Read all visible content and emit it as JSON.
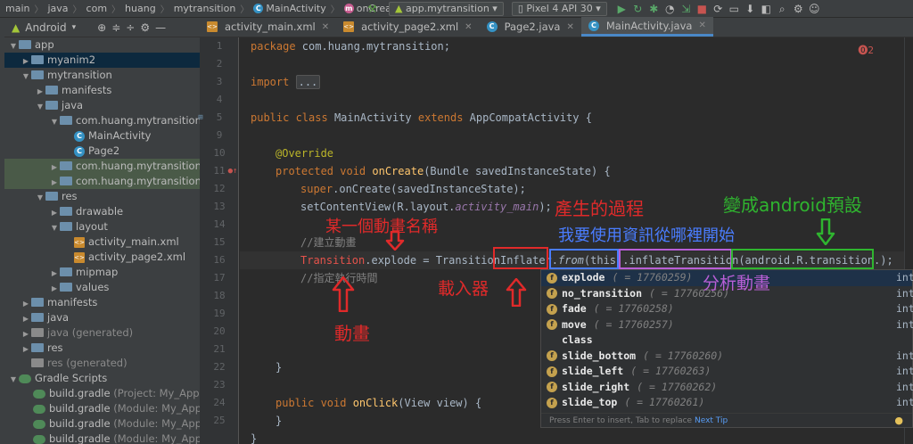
{
  "breadcrumbs": [
    "main",
    "java",
    "com",
    "huang",
    "mytransition",
    "MainActivity",
    "onCreate"
  ],
  "toolbar": {
    "config": "app.mytransition",
    "device": "Pixel 4 API 30"
  },
  "project": {
    "view": "Android",
    "items": [
      {
        "label": "app"
      },
      {
        "label": "myanim2"
      },
      {
        "label": "mytransition"
      },
      {
        "label": "manifests"
      },
      {
        "label": "java"
      },
      {
        "label": "com.huang.mytransition"
      },
      {
        "label": "MainActivity"
      },
      {
        "label": "Page2"
      },
      {
        "label": "com.huang.mytransition"
      },
      {
        "label": "com.huang.mytransition"
      },
      {
        "label": "res"
      },
      {
        "label": "drawable"
      },
      {
        "label": "layout"
      },
      {
        "label": "activity_main.xml"
      },
      {
        "label": "activity_page2.xml"
      },
      {
        "label": "mipmap"
      },
      {
        "label": "values"
      },
      {
        "label": "manifests"
      },
      {
        "label": "java"
      },
      {
        "label": "java (generated)"
      },
      {
        "label": "res"
      },
      {
        "label": "res (generated)"
      },
      {
        "label": "Gradle Scripts"
      },
      {
        "label": "build.gradle",
        "note": "(Project: My_Applic"
      },
      {
        "label": "build.gradle",
        "note": "(Module: My_Applic"
      },
      {
        "label": "build.gradle",
        "note": "(Module: My_Applic"
      },
      {
        "label": "build.gradle",
        "note": "(Module: My_Applic"
      }
    ]
  },
  "tabs": [
    {
      "label": "activity_main.xml"
    },
    {
      "label": "activity_page2.xml"
    },
    {
      "label": "Page2.java"
    },
    {
      "label": "MainActivity.java"
    }
  ],
  "editor": {
    "error_count": "2",
    "line_numbers": [
      "1",
      "2",
      "3",
      "4",
      "5",
      "9",
      "10",
      "11",
      "12",
      "13",
      "14",
      "15",
      "16",
      "17",
      "18",
      "19",
      "20",
      "21",
      "22",
      "23",
      "24",
      "25"
    ],
    "t_package": "package",
    "t_package_name": " com.huang.mytransition;",
    "t_import": "import",
    "t_import_fold": "...",
    "t_public": "public",
    "t_class": " class",
    "t_classname": " MainActivity",
    "t_extends": " extends",
    "t_super_class": " AppCompatActivity {",
    "t_override": "@Override",
    "t_protected": "protected",
    "t_void": " void",
    "t_oncreate": " onCreate",
    "t_oncreate_args": "(Bundle savedInstanceState) {",
    "t_super": "super",
    "t_super_rest": ".onCreate(savedInstanceState);",
    "t_setcv": "setContentView(R.layout.",
    "t_layout": "activity_main",
    "t_setcv_end": ");",
    "t_comment1": "//建立動畫",
    "t_transition": "Transition",
    "t_explode": ".explode = TransitionInflater.",
    "t_from": "from",
    "t_from_args": "(this).",
    "t_inflate": "inflateTransition",
    "t_paren": "(",
    "t_android": "android.R.transition.",
    "t_end": ");",
    "t_comment2": "//指定執行時間",
    "t_close_brace": "}",
    "t_public2": "public",
    "t_void2": " void",
    "t_onclick": " onClick",
    "t_onclick_args": "(View view) {",
    "t_close1": "}",
    "t_close2": "}"
  },
  "completion": {
    "items": [
      {
        "name": "explode",
        "value": "( = 17760259)",
        "type": "int"
      },
      {
        "name": "no_transition",
        "value": "( = 17760256)",
        "type": "int"
      },
      {
        "name": "fade",
        "value": "( = 17760258)",
        "type": "int"
      },
      {
        "name": "move",
        "value": "( = 17760257)",
        "type": "int"
      },
      {
        "name": "class",
        "value": "",
        "type": ""
      },
      {
        "name": "slide_bottom",
        "value": "( = 17760260)",
        "type": "int"
      },
      {
        "name": "slide_left",
        "value": "( = 17760263)",
        "type": "int"
      },
      {
        "name": "slide_right",
        "value": "( = 17760262)",
        "type": "int"
      },
      {
        "name": "slide_top",
        "value": "( = 17760261)",
        "type": "int"
      }
    ],
    "footer": "Press Enter to insert, Tab to replace",
    "next_tip": "Next Tip"
  },
  "annotations": {
    "anim_name": "某一個動畫名稱",
    "process": "產生的過程",
    "source": "我要使用資訊從哪裡開始",
    "default": "變成android預設",
    "loader": "載入器",
    "analyze": "分析動畫",
    "anim": "動畫"
  },
  "colors": {
    "red": "#e02a2a",
    "blue": "#4a7dff",
    "purple": "#b85fd6",
    "green": "#2fb52f"
  }
}
